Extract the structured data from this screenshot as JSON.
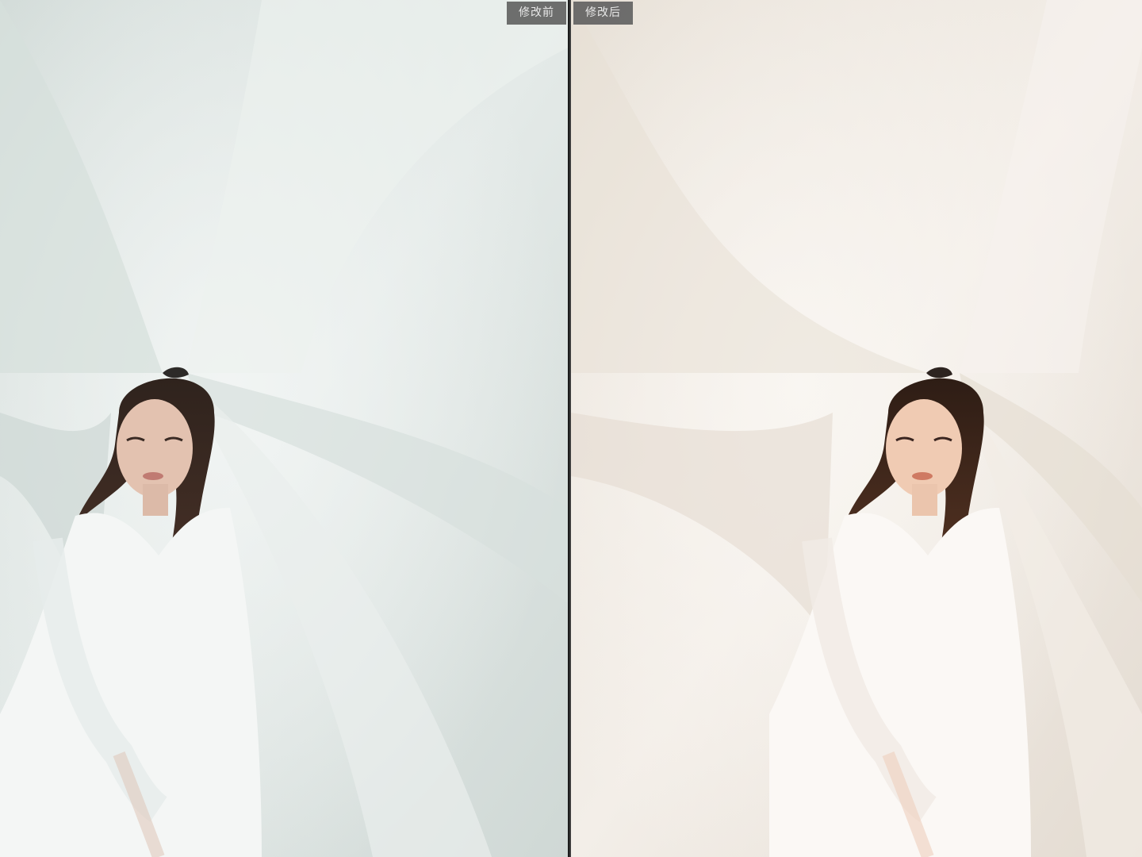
{
  "compare": {
    "before_label": "修改前",
    "after_label": "修改后"
  },
  "photo": {
    "before_tint": "#dfe6e3",
    "after_tint": "#f0ebe4"
  }
}
